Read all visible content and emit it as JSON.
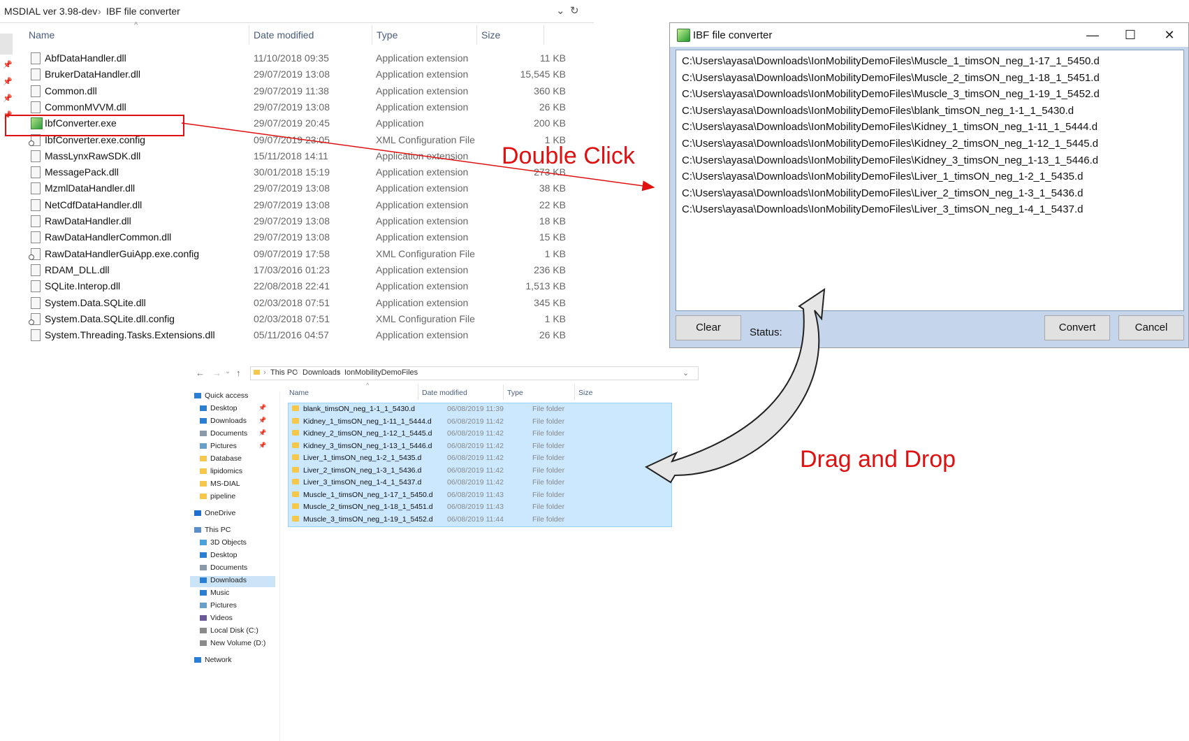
{
  "explorer_top": {
    "app_title": "MSDIAL ver 3.98-dev",
    "folder": "IBF file converter",
    "columns": {
      "name": "Name",
      "date": "Date modified",
      "type": "Type",
      "size": "Size"
    },
    "files": [
      {
        "name": "AbfDataHandler.dll",
        "date": "11/10/2018 09:35",
        "type": "Application extension",
        "size": "11 KB",
        "icon": "dll-file-icon"
      },
      {
        "name": "BrukerDataHandler.dll",
        "date": "29/07/2019 13:08",
        "type": "Application extension",
        "size": "15,545 KB",
        "icon": "dll-file-icon"
      },
      {
        "name": "Common.dll",
        "date": "29/07/2019 11:38",
        "type": "Application extension",
        "size": "360 KB",
        "icon": "dll-file-icon"
      },
      {
        "name": "CommonMVVM.dll",
        "date": "29/07/2019 13:08",
        "type": "Application extension",
        "size": "26 KB",
        "icon": "dll-file-icon"
      },
      {
        "name": "IbfConverter.exe",
        "date": "29/07/2019 20:45",
        "type": "Application",
        "size": "200 KB",
        "icon": "exe-file-icon"
      },
      {
        "name": "IbfConverter.exe.config",
        "date": "09/07/2019 23:05",
        "type": "XML Configuration File",
        "size": "1 KB",
        "icon": "config-file-icon"
      },
      {
        "name": "MassLynxRawSDK.dll",
        "date": "15/11/2018 14:11",
        "type": "Application extension",
        "size": "",
        "icon": "dll-file-icon"
      },
      {
        "name": "MessagePack.dll",
        "date": "30/01/2018 15:19",
        "type": "Application extension",
        "size": "273 KB",
        "icon": "dll-file-icon"
      },
      {
        "name": "MzmlDataHandler.dll",
        "date": "29/07/2019 13:08",
        "type": "Application extension",
        "size": "38 KB",
        "icon": "dll-file-icon"
      },
      {
        "name": "NetCdfDataHandler.dll",
        "date": "29/07/2019 13:08",
        "type": "Application extension",
        "size": "22 KB",
        "icon": "dll-file-icon"
      },
      {
        "name": "RawDataHandler.dll",
        "date": "29/07/2019 13:08",
        "type": "Application extension",
        "size": "18 KB",
        "icon": "dll-file-icon"
      },
      {
        "name": "RawDataHandlerCommon.dll",
        "date": "29/07/2019 13:08",
        "type": "Application extension",
        "size": "15 KB",
        "icon": "dll-file-icon"
      },
      {
        "name": "RawDataHandlerGuiApp.exe.config",
        "date": "09/07/2019 17:58",
        "type": "XML Configuration File",
        "size": "1 KB",
        "icon": "config-file-icon"
      },
      {
        "name": "RDAM_DLL.dll",
        "date": "17/03/2016 01:23",
        "type": "Application extension",
        "size": "236 KB",
        "icon": "dll-file-icon"
      },
      {
        "name": "SQLite.Interop.dll",
        "date": "22/08/2018 22:41",
        "type": "Application extension",
        "size": "1,513 KB",
        "icon": "dll-file-icon"
      },
      {
        "name": "System.Data.SQLite.dll",
        "date": "02/03/2018 07:51",
        "type": "Application extension",
        "size": "345 KB",
        "icon": "dll-file-icon"
      },
      {
        "name": "System.Data.SQLite.dll.config",
        "date": "02/03/2018 07:51",
        "type": "XML Configuration File",
        "size": "1 KB",
        "icon": "config-file-icon"
      },
      {
        "name": "System.Threading.Tasks.Extensions.dll",
        "date": "05/11/2016 04:57",
        "type": "Application extension",
        "size": "26 KB",
        "icon": "dll-file-icon"
      }
    ]
  },
  "converter": {
    "title": "IBF file converter",
    "window_buttons": {
      "minimize": "—",
      "maximize": "☐",
      "close": "✕"
    },
    "paths": [
      "C:\\Users\\ayasa\\Downloads\\IonMobilityDemoFiles\\Muscle_1_timsON_neg_1-17_1_5450.d",
      "C:\\Users\\ayasa\\Downloads\\IonMobilityDemoFiles\\Muscle_2_timsON_neg_1-18_1_5451.d",
      "C:\\Users\\ayasa\\Downloads\\IonMobilityDemoFiles\\Muscle_3_timsON_neg_1-19_1_5452.d",
      "C:\\Users\\ayasa\\Downloads\\IonMobilityDemoFiles\\blank_timsON_neg_1-1_1_5430.d",
      "C:\\Users\\ayasa\\Downloads\\IonMobilityDemoFiles\\Kidney_1_timsON_neg_1-11_1_5444.d",
      "C:\\Users\\ayasa\\Downloads\\IonMobilityDemoFiles\\Kidney_2_timsON_neg_1-12_1_5445.d",
      "C:\\Users\\ayasa\\Downloads\\IonMobilityDemoFiles\\Kidney_3_timsON_neg_1-13_1_5446.d",
      "C:\\Users\\ayasa\\Downloads\\IonMobilityDemoFiles\\Liver_1_timsON_neg_1-2_1_5435.d",
      "C:\\Users\\ayasa\\Downloads\\IonMobilityDemoFiles\\Liver_2_timsON_neg_1-3_1_5436.d",
      "C:\\Users\\ayasa\\Downloads\\IonMobilityDemoFiles\\Liver_3_timsON_neg_1-4_1_5437.d"
    ],
    "clear_label": "Clear",
    "status_label": "Status:",
    "convert_label": "Convert",
    "cancel_label": "Cancel"
  },
  "explorer_bottom": {
    "breadcrumb": [
      "This PC",
      "Downloads",
      "IonMobilityDemoFiles"
    ],
    "columns": {
      "name": "Name",
      "date": "Date modified",
      "type": "Type",
      "size": "Size"
    },
    "nav": [
      {
        "label": "Quick access",
        "icon": "star-icon"
      },
      {
        "label": "Desktop",
        "icon": "desktop-icon",
        "pinned": true
      },
      {
        "label": "Downloads",
        "icon": "download-icon",
        "pinned": true
      },
      {
        "label": "Documents",
        "icon": "documents-icon",
        "pinned": true
      },
      {
        "label": "Pictures",
        "icon": "pictures-icon",
        "pinned": true
      },
      {
        "label": "Database",
        "icon": "folder-icon"
      },
      {
        "label": "lipidomics",
        "icon": "folder-icon"
      },
      {
        "label": "MS-DIAL",
        "icon": "folder-icon"
      },
      {
        "label": "pipeline",
        "icon": "folder-icon"
      },
      {
        "label": "OneDrive",
        "icon": "cloud-icon"
      },
      {
        "label": "This PC",
        "icon": "computer-icon"
      },
      {
        "label": "3D Objects",
        "icon": "cube-icon"
      },
      {
        "label": "Desktop",
        "icon": "desktop-icon"
      },
      {
        "label": "Documents",
        "icon": "documents-icon"
      },
      {
        "label": "Downloads",
        "icon": "download-icon",
        "active": true
      },
      {
        "label": "Music",
        "icon": "music-icon"
      },
      {
        "label": "Pictures",
        "icon": "pictures-icon"
      },
      {
        "label": "Videos",
        "icon": "video-icon"
      },
      {
        "label": "Local Disk (C:)",
        "icon": "disk-icon"
      },
      {
        "label": "New Volume (D:)",
        "icon": "disk-icon"
      },
      {
        "label": "Network",
        "icon": "network-icon"
      }
    ],
    "folders": [
      {
        "name": "blank_timsON_neg_1-1_1_5430.d",
        "date": "06/08/2019 11:39",
        "type": "File folder"
      },
      {
        "name": "Kidney_1_timsON_neg_1-11_1_5444.d",
        "date": "06/08/2019 11:42",
        "type": "File folder"
      },
      {
        "name": "Kidney_2_timsON_neg_1-12_1_5445.d",
        "date": "06/08/2019 11:42",
        "type": "File folder"
      },
      {
        "name": "Kidney_3_timsON_neg_1-13_1_5446.d",
        "date": "06/08/2019 11:42",
        "type": "File folder"
      },
      {
        "name": "Liver_1_timsON_neg_1-2_1_5435.d",
        "date": "06/08/2019 11:42",
        "type": "File folder"
      },
      {
        "name": "Liver_2_timsON_neg_1-3_1_5436.d",
        "date": "06/08/2019 11:42",
        "type": "File folder"
      },
      {
        "name": "Liver_3_timsON_neg_1-4_1_5437.d",
        "date": "06/08/2019 11:42",
        "type": "File folder"
      },
      {
        "name": "Muscle_1_timsON_neg_1-17_1_5450.d",
        "date": "06/08/2019 11:43",
        "type": "File folder"
      },
      {
        "name": "Muscle_2_timsON_neg_1-18_1_5451.d",
        "date": "06/08/2019 11:43",
        "type": "File folder"
      },
      {
        "name": "Muscle_3_timsON_neg_1-19_1_5452.d",
        "date": "06/08/2019 11:44",
        "type": "File folder"
      }
    ]
  },
  "annotations": {
    "double_click": "Double Click",
    "drag_drop": "Drag and Drop",
    "color": "#e01010"
  }
}
